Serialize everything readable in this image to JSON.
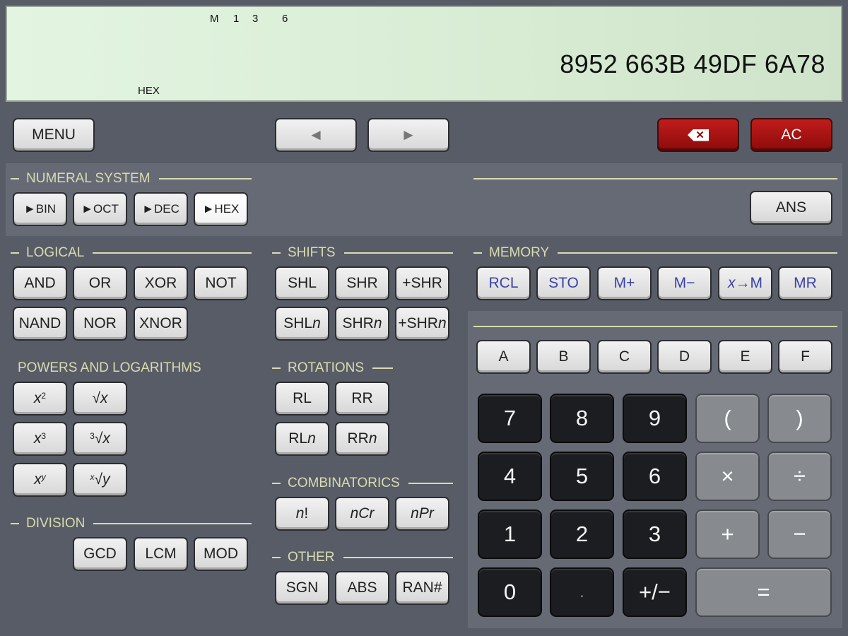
{
  "display": {
    "mem_indicator": "M",
    "indicator_1": "1",
    "indicator_3": "3",
    "indicator_6": "6",
    "mode": "HEX",
    "value": "8952 663B 49DF 6A78"
  },
  "top": {
    "menu": "MENU",
    "left": "◄",
    "right": "►",
    "ac": "AC"
  },
  "numeral": {
    "title": "NUMERAL SYSTEM",
    "bin": "►BIN",
    "oct": "►OCT",
    "dec": "►DEC",
    "hex": "►HEX",
    "selected": "HEX",
    "ans": "ANS"
  },
  "logical": {
    "title": "LOGICAL",
    "and": "AND",
    "or": "OR",
    "xor": "XOR",
    "not": "NOT",
    "nand": "NAND",
    "nor": "NOR",
    "xnor": "XNOR"
  },
  "shifts": {
    "title": "SHIFTS",
    "shl": "SHL",
    "shr": "SHR",
    "pshr": "+SHR",
    "shl_prefix": "SHL",
    "shr_prefix": "SHR",
    "pshr_prefix": "+SHR",
    "n": "n"
  },
  "memory": {
    "title": "MEMORY",
    "rcl": "RCL",
    "sto": "STO",
    "mplus": "M+",
    "mminus": "M−",
    "x": "x",
    "tom": "→M",
    "mr": "MR"
  },
  "powers": {
    "title": "POWERS AND LOGARITHMS",
    "x": "x",
    "y": "y",
    "two": "2",
    "three": "3",
    "root": "√"
  },
  "rotations": {
    "title": "ROTATIONS",
    "rl": "RL",
    "rr": "RR",
    "n": "n"
  },
  "combinatorics": {
    "title": "COMBINATORICS",
    "n": "n",
    "fact": "!",
    "cr": "Cr",
    "pr": "Pr"
  },
  "division": {
    "title": "DIVISION",
    "gcd": "GCD",
    "lcm": "LCM",
    "mod": "MOD"
  },
  "other": {
    "title": "OTHER",
    "sgn": "SGN",
    "abs": "ABS",
    "ran": "RAN#"
  },
  "hexdigits": [
    "A",
    "B",
    "C",
    "D",
    "E",
    "F"
  ],
  "keypad": {
    "k7": "7",
    "k8": "8",
    "k9": "9",
    "lparen": "(",
    "rparen": ")",
    "k4": "4",
    "k5": "5",
    "k6": "6",
    "mul": "×",
    "div": "÷",
    "k1": "1",
    "k2": "2",
    "k3": "3",
    "plus": "+",
    "minus": "−",
    "k0": "0",
    "dot": ".",
    "neg": "+/−",
    "eq": "="
  },
  "colors": {
    "lcd": "#e3f5e1",
    "accent_red": "#a81414",
    "memory_text": "#3b41a8",
    "section_text": "#d8dcb0"
  }
}
